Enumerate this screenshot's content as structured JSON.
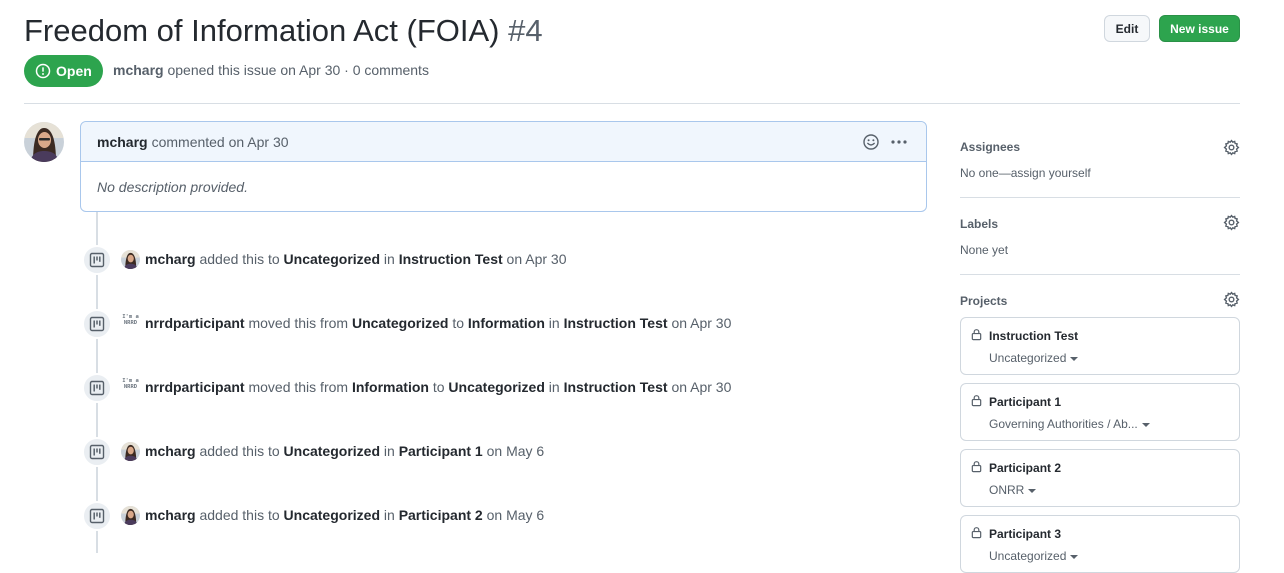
{
  "issue": {
    "title": "Freedom of Information Act (FOIA)",
    "number": "#4",
    "state": "Open",
    "author": "mcharg",
    "meta_rest": "opened this issue on Apr 30 · 0 comments"
  },
  "header_buttons": {
    "edit": "Edit",
    "new_issue": "New issue"
  },
  "comment": {
    "author": "mcharg",
    "action": "commented on Apr 30",
    "body": "No description provided."
  },
  "timeline": [
    {
      "actor": "mcharg",
      "avatar": "photo",
      "p1": "added this to",
      "from": "Uncategorized",
      "p2": "in",
      "to": "Instruction Test",
      "p3": "",
      "project": "",
      "date": "on Apr 30"
    },
    {
      "actor": "nrrdparticipant",
      "avatar": "logo",
      "p1": "moved this from",
      "from": "Uncategorized",
      "p2": "to",
      "to": "Information",
      "p3": "in",
      "project": "Instruction Test",
      "date": "on Apr 30"
    },
    {
      "actor": "nrrdparticipant",
      "avatar": "logo",
      "p1": "moved this from",
      "from": "Information",
      "p2": "to",
      "to": "Uncategorized",
      "p3": "in",
      "project": "Instruction Test",
      "date": "on Apr 30"
    },
    {
      "actor": "mcharg",
      "avatar": "photo",
      "p1": "added this to",
      "from": "Uncategorized",
      "p2": "in",
      "to": "Participant 1",
      "p3": "",
      "project": "",
      "date": "on May 6"
    },
    {
      "actor": "mcharg",
      "avatar": "photo",
      "p1": "added this to",
      "from": "Uncategorized",
      "p2": "in",
      "to": "Participant 2",
      "p3": "",
      "project": "",
      "date": "on May 6"
    }
  ],
  "sidebar": {
    "assignees": {
      "heading": "Assignees",
      "value": "No one—assign yourself"
    },
    "labels": {
      "heading": "Labels",
      "value": "None yet"
    },
    "projects": {
      "heading": "Projects",
      "items": [
        {
          "name": "Instruction Test",
          "column": "Uncategorized"
        },
        {
          "name": "Participant 1",
          "column": "Governing Authorities / Ab..."
        },
        {
          "name": "Participant 2",
          "column": "ONRR"
        },
        {
          "name": "Participant 3",
          "column": "Uncategorized"
        }
      ]
    }
  },
  "colors": {
    "open_green": "#2da44e",
    "link_text": "#24292f",
    "muted": "#57606a",
    "comment_border": "#a9c7ec"
  },
  "avatar_logo_text": "I'm a NRRD"
}
